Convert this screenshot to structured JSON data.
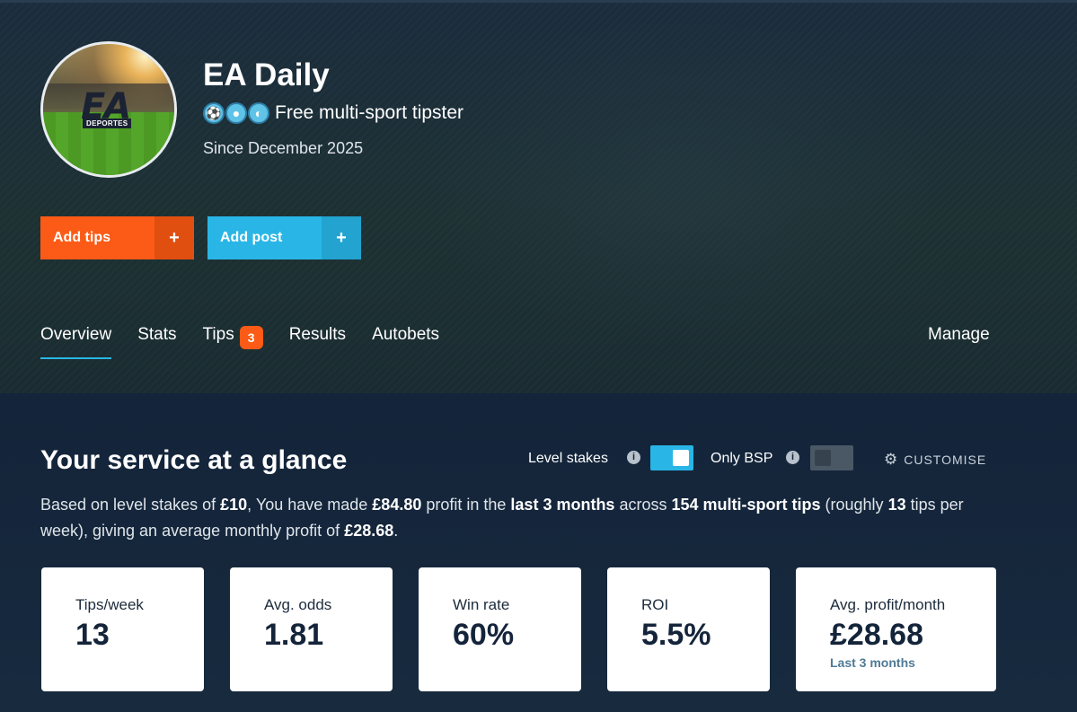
{
  "profile": {
    "name": "EA Daily",
    "avatar_text": "EA",
    "avatar_subtext": "DEPORTES",
    "sport_icons": [
      "football-icon",
      "basketball-icon",
      "baseball-icon"
    ],
    "subtitle": "Free multi-sport tipster",
    "since": "Since December 2025"
  },
  "actions": {
    "add_tips": "Add tips",
    "add_post": "Add post",
    "plus": "+"
  },
  "nav": {
    "overview": "Overview",
    "stats": "Stats",
    "tips": "Tips",
    "tips_badge": "3",
    "results": "Results",
    "autobets": "Autobets",
    "manage": "Manage"
  },
  "glance": {
    "title": "Your service at a glance",
    "level_stakes_label": "Level stakes",
    "level_stakes_on": true,
    "only_bsp_label": "Only BSP",
    "only_bsp_on": false,
    "info": "i",
    "customise": "CUSTOMISE",
    "summary": {
      "t1": "Based on level stakes of ",
      "stake": "£10",
      "t2": ", You have made ",
      "profit": "£84.80",
      "t3": " profit in the ",
      "period": "last 3 months",
      "t4": " across ",
      "tip_count": "154 multi-sport tips",
      "t5": " (roughly ",
      "per_week": "13",
      "t6": " tips per week), giving an average monthly profit of ",
      "monthly": "£28.68",
      "t7": "."
    }
  },
  "stats": [
    {
      "label": "Tips/week",
      "value": "13"
    },
    {
      "label": "Avg. odds",
      "value": "1.81"
    },
    {
      "label": "Win rate",
      "value": "60%"
    },
    {
      "label": "ROI",
      "value": "5.5%"
    },
    {
      "label": "Avg. profit/month",
      "value": "£28.68",
      "sub": "Last 3 months"
    }
  ],
  "colors": {
    "accent_orange": "#fb5b16",
    "accent_blue": "#29b6e6",
    "background": "#162638"
  }
}
